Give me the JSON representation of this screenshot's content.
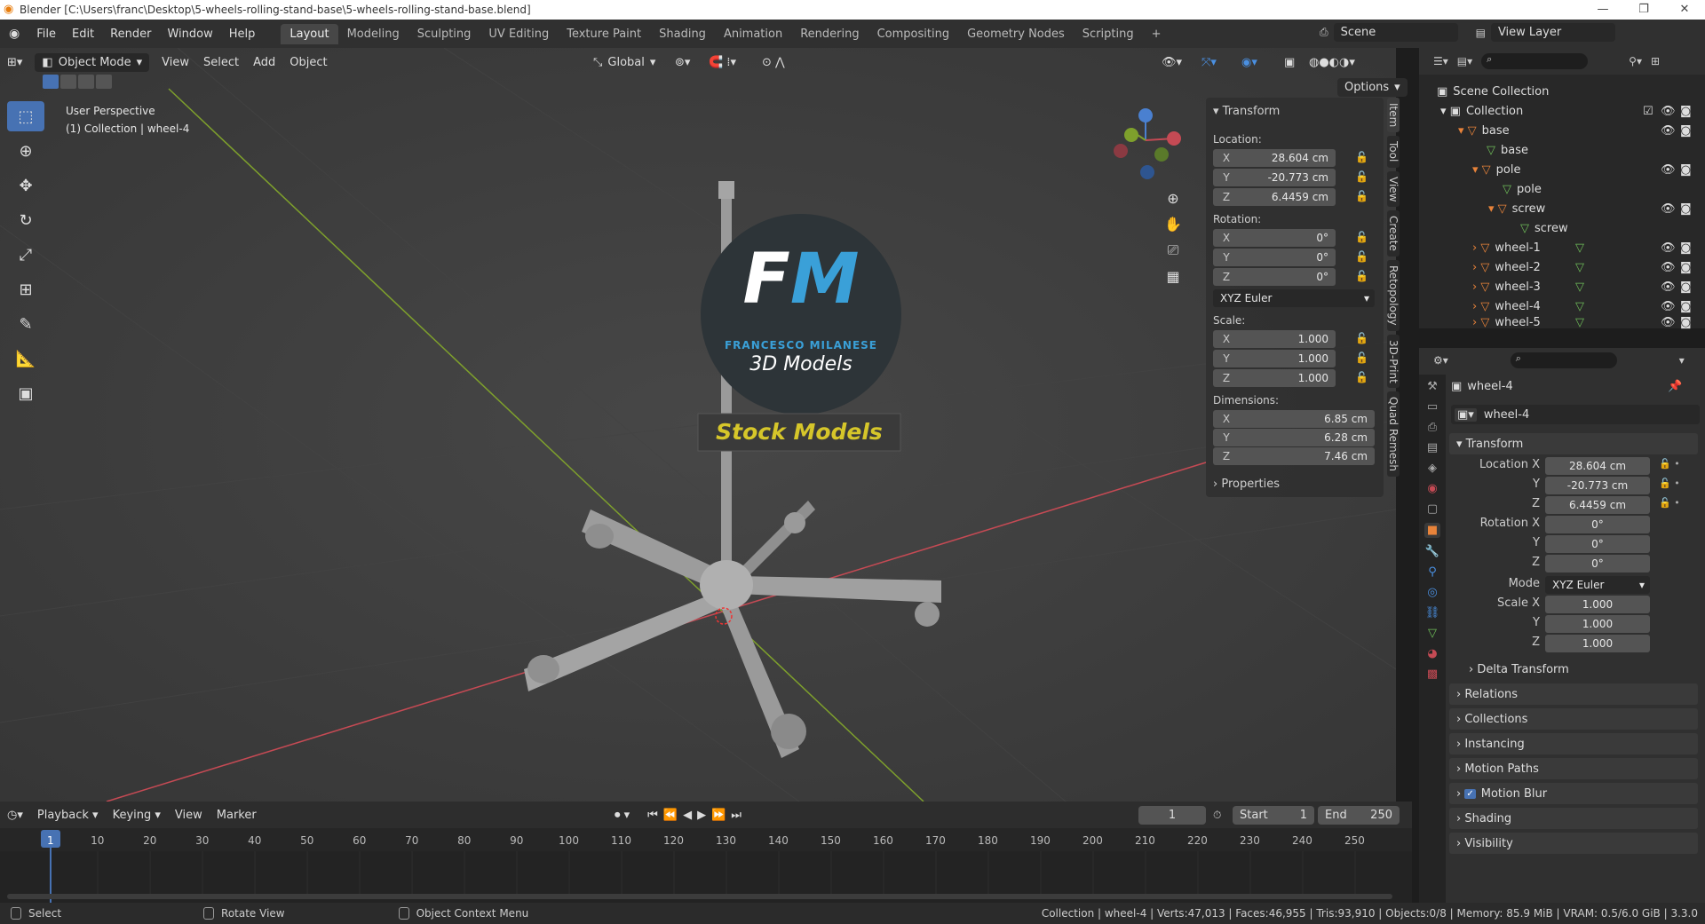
{
  "window": {
    "title": "Blender [C:\\Users\\franc\\Desktop\\5-wheels-rolling-stand-base\\5-wheels-rolling-stand-base.blend]"
  },
  "menus": [
    "File",
    "Edit",
    "Render",
    "Window",
    "Help"
  ],
  "workspaces": [
    "Layout",
    "Modeling",
    "Sculpting",
    "UV Editing",
    "Texture Paint",
    "Shading",
    "Animation",
    "Rendering",
    "Compositing",
    "Geometry Nodes",
    "Scripting"
  ],
  "scene": {
    "name": "Scene",
    "view_layer": "View Layer"
  },
  "viewport": {
    "mode": "Object Mode",
    "menu": [
      "View",
      "Select",
      "Add",
      "Object"
    ],
    "orientation": "Global",
    "options": "Options",
    "overlay_text": [
      "User Perspective",
      "(1) Collection | wheel-4"
    ],
    "watermark": {
      "initials": "FM",
      "name": "FRANCESCO MILANESE",
      "subtitle": "3D Models",
      "banner": "Stock Models"
    }
  },
  "npanel": {
    "header": "Transform",
    "location_label": "Location:",
    "location": {
      "x": "28.604 cm",
      "y": "-20.773 cm",
      "z": "6.4459 cm"
    },
    "rotation_label": "Rotation:",
    "rotation": {
      "x": "0°",
      "y": "0°",
      "z": "0°"
    },
    "rotation_mode": "XYZ Euler",
    "scale_label": "Scale:",
    "scale": {
      "x": "1.000",
      "y": "1.000",
      "z": "1.000"
    },
    "dimensions_label": "Dimensions:",
    "dimensions": {
      "x": "6.85 cm",
      "y": "6.28 cm",
      "z": "7.46 cm"
    },
    "properties": "Properties",
    "axis": {
      "x": "X",
      "y": "Y",
      "z": "Z"
    },
    "tabs": [
      "Item",
      "Tool",
      "View",
      "Create",
      "Retopology",
      "3D-Print",
      "Quad Remesh"
    ]
  },
  "outliner": {
    "rows": [
      "Scene Collection",
      "Collection",
      "base",
      "base",
      "pole",
      "pole",
      "screw",
      "screw",
      "wheel-1",
      "wheel-2",
      "wheel-3",
      "wheel-4",
      "wheel-5"
    ]
  },
  "properties": {
    "object_name": "wheel-4",
    "data_name": "wheel-4",
    "transform_header": "Transform",
    "location_label": "Location X",
    "location": {
      "x": "28.604 cm",
      "y": "-20.773 cm",
      "z": "6.4459 cm"
    },
    "rotation_label": "Rotation X",
    "rotation": {
      "x": "0°",
      "y": "0°",
      "z": "0°"
    },
    "mode_label": "Mode",
    "mode": "XYZ Euler",
    "scale_label": "Scale X",
    "scale": {
      "x": "1.000",
      "y": "1.000",
      "z": "1.000"
    },
    "y_label": "Y",
    "z_label": "Z",
    "sections": [
      "Delta Transform",
      "Relations",
      "Collections",
      "Instancing",
      "Motion Paths",
      "Motion Blur",
      "Shading",
      "Visibility"
    ]
  },
  "timeline": {
    "menu": [
      "Playback",
      "Keying",
      "View",
      "Marker"
    ],
    "current_frame": "1",
    "start_label": "Start",
    "start": "1",
    "end_label": "End",
    "end": "250",
    "frame_ticks": [
      "1",
      "10",
      "20",
      "30",
      "40",
      "50",
      "60",
      "70",
      "80",
      "90",
      "100",
      "110",
      "120",
      "130",
      "140",
      "150",
      "160",
      "170",
      "180",
      "190",
      "200",
      "210",
      "220",
      "230",
      "240",
      "250"
    ]
  },
  "statusbar": {
    "left": [
      "Select",
      "Rotate View",
      "Object Context Menu"
    ],
    "right": "Collection | wheel-4 | Verts:47,013 | Faces:46,955 | Tris:93,910 | Objects:0/8 | Memory: 85.9 MiB | VRAM: 0.5/6.0 GiB | 3.3.0"
  },
  "colors": {
    "accent": "#4772b3",
    "object_orange": "#e8833a",
    "mesh_green": "#6fbf5a",
    "x_axis": "#c54a54",
    "y_axis": "#7ea02c"
  }
}
